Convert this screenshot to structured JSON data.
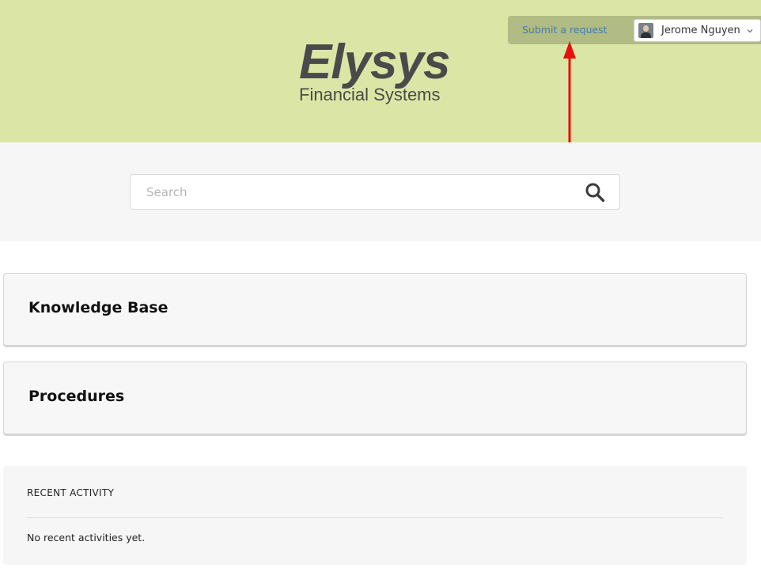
{
  "header": {
    "logo": {
      "name": "Elysys",
      "tagline": "Financial Systems"
    },
    "submit_request": "Submit a request",
    "user": {
      "name": "Jerome Nguyen",
      "avatar_icon": "user-avatar"
    },
    "background_color": "#dbe6a6",
    "bar_color": "#b1bb84"
  },
  "annotation": {
    "color": "#e8100e",
    "icon": "arrow-up-annotation"
  },
  "search": {
    "placeholder": "Search",
    "icon": "search-icon"
  },
  "sections": [
    {
      "title": "Knowledge Base"
    },
    {
      "title": "Procedures"
    }
  ],
  "recent_activity": {
    "title": "RECENT ACTIVITY",
    "empty_message": "No recent activities yet."
  }
}
